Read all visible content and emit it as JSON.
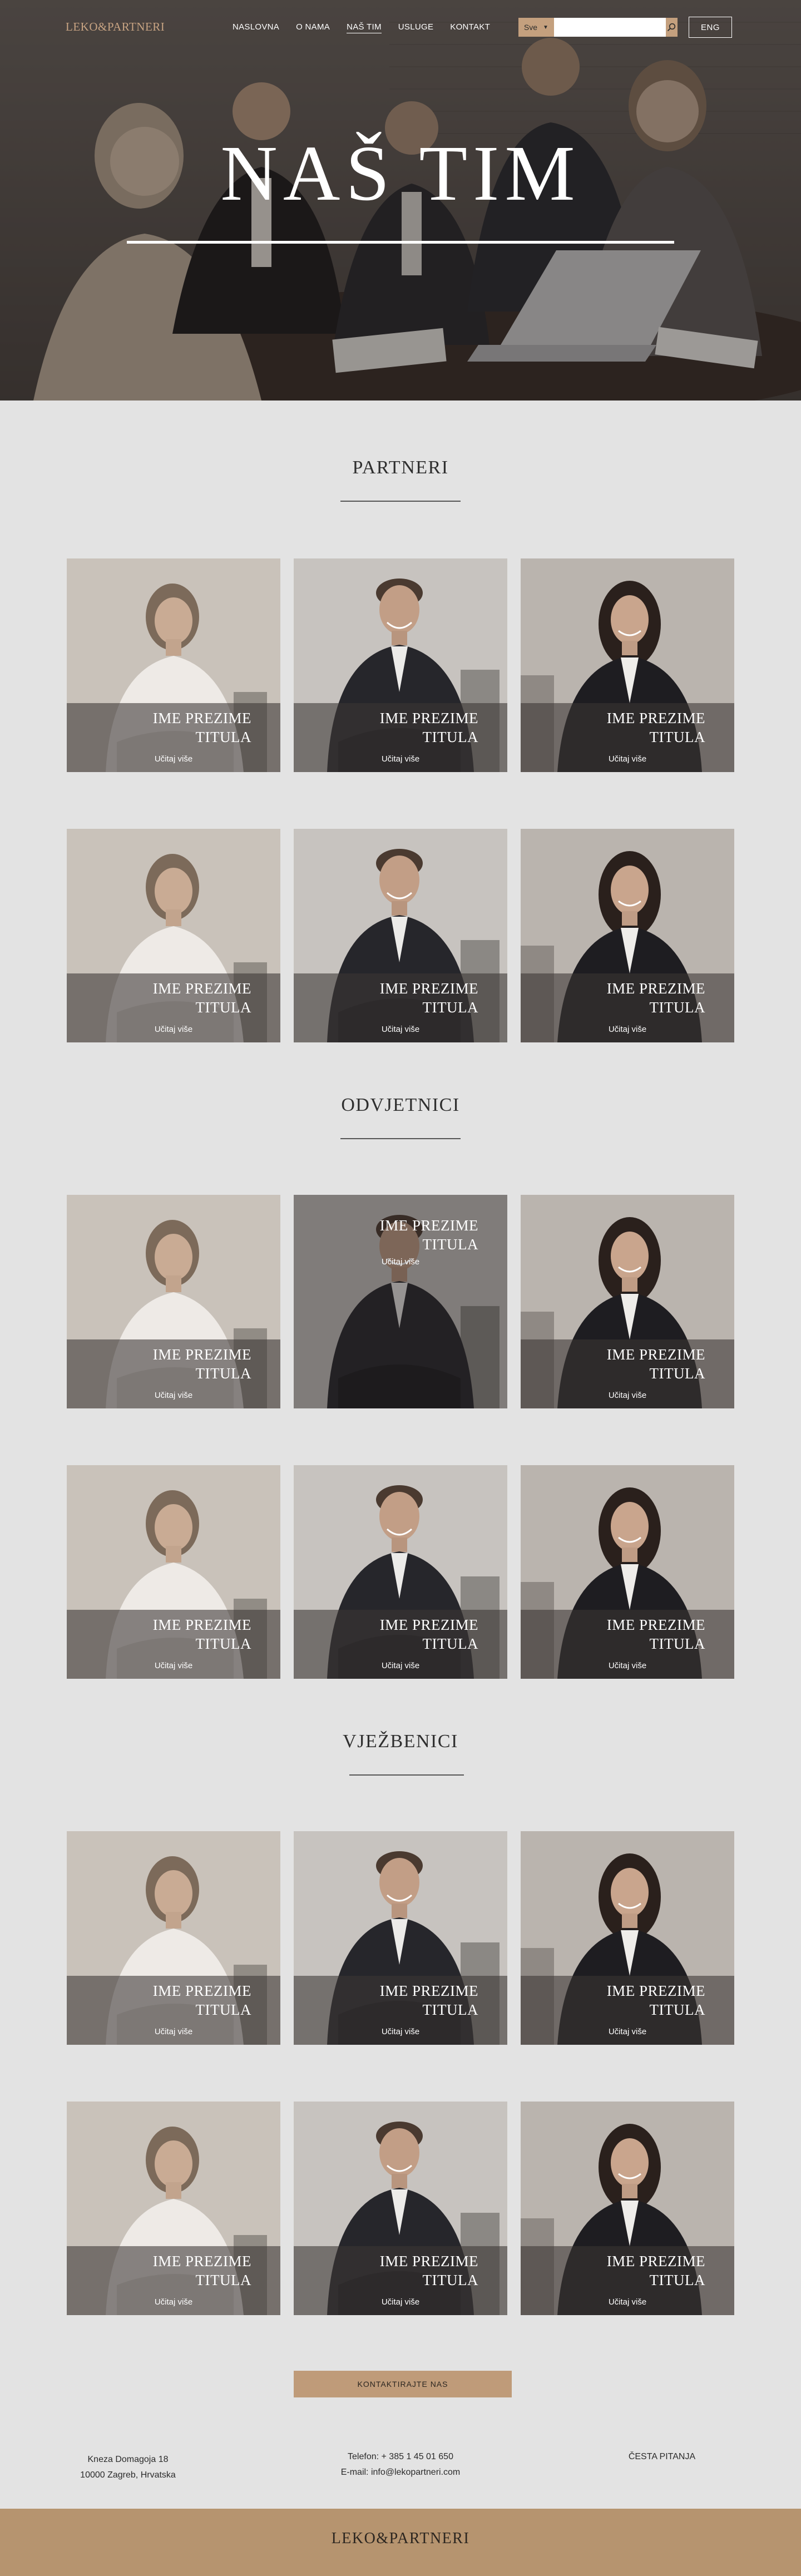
{
  "brand": {
    "logo": "LEKO&PARTNERI",
    "accent": "#c4a07e",
    "footer_bg": "#b6946f"
  },
  "nav": {
    "items": [
      {
        "label": "NASLOVNA"
      },
      {
        "label": "O NAMA"
      },
      {
        "label": "NAŠ TIM"
      },
      {
        "label": "USLUGE"
      },
      {
        "label": "KONTAKT"
      }
    ],
    "active": "NAŠ TIM",
    "search": {
      "filter_value": "Sve",
      "placeholder": "",
      "icon": "search-icon",
      "filter_icon": "caret-down-icon"
    },
    "lang": "ENG"
  },
  "hero": {
    "title": "NAŠ TIM"
  },
  "sections": [
    {
      "title": "PARTNERI",
      "cards": [
        {
          "name": "IME PREZIME",
          "title": "TITULA",
          "more": "Učitaj više",
          "photo": "woman-blonde"
        },
        {
          "name": "IME PREZIME",
          "title": "TITULA",
          "more": "Učitaj više",
          "photo": "man-suit"
        },
        {
          "name": "IME PREZIME",
          "title": "TITULA",
          "more": "Učitaj više",
          "photo": "woman-dark"
        },
        {
          "name": "IME PREZIME",
          "title": "TITULA",
          "more": "Učitaj više",
          "photo": "woman-blonde"
        },
        {
          "name": "IME PREZIME",
          "title": "TITULA",
          "more": "Učitaj više",
          "photo": "man-suit"
        },
        {
          "name": "IME PREZIME",
          "title": "TITULA",
          "more": "Učitaj više",
          "photo": "woman-dark"
        }
      ]
    },
    {
      "title": "ODVJETNICI",
      "cards": [
        {
          "name": "IME PREZIME",
          "title": "TITULA",
          "more": "Učitaj više",
          "photo": "woman-blonde"
        },
        {
          "name": "IME PREZIME",
          "title": "TITULA",
          "more": "Učitaj više",
          "photo": "man-suit",
          "hover": true
        },
        {
          "name": "IME PREZIME",
          "title": "TITULA",
          "more": "Učitaj više",
          "photo": "woman-dark"
        },
        {
          "name": "IME PREZIME",
          "title": "TITULA",
          "more": "Učitaj više",
          "photo": "woman-blonde"
        },
        {
          "name": "IME PREZIME",
          "title": "TITULA",
          "more": "Učitaj više",
          "photo": "man-suit"
        },
        {
          "name": "IME PREZIME",
          "title": "TITULA",
          "more": "Učitaj više",
          "photo": "woman-dark"
        }
      ]
    },
    {
      "title": "VJEŽBENICI",
      "cards": [
        {
          "name": "IME PREZIME",
          "title": "TITULA",
          "more": "Učitaj više",
          "photo": "woman-blonde"
        },
        {
          "name": "IME PREZIME",
          "title": "TITULA",
          "more": "Učitaj više",
          "photo": "man-suit"
        },
        {
          "name": "IME PREZIME",
          "title": "TITULA",
          "more": "Učitaj više",
          "photo": "woman-dark"
        },
        {
          "name": "IME PREZIME",
          "title": "TITULA",
          "more": "Učitaj više",
          "photo": "woman-blonde"
        },
        {
          "name": "IME PREZIME",
          "title": "TITULA",
          "more": "Učitaj više",
          "photo": "man-suit"
        },
        {
          "name": "IME PREZIME",
          "title": "TITULA",
          "more": "Učitaj više",
          "photo": "woman-dark"
        }
      ]
    }
  ],
  "cta": {
    "label": "KONTAKTIRAJTE NAS"
  },
  "footer": {
    "address_line1": "Kneza Domagoja 18",
    "address_line2": "10000 Zagreb, Hrvatska",
    "phone": "Telefon: + 385 1 45 01 650",
    "email": "E-mail: info@lekopartneri.com",
    "faq": "ČESTA PITANJA",
    "logo": "LEKO&PARTNERI"
  }
}
